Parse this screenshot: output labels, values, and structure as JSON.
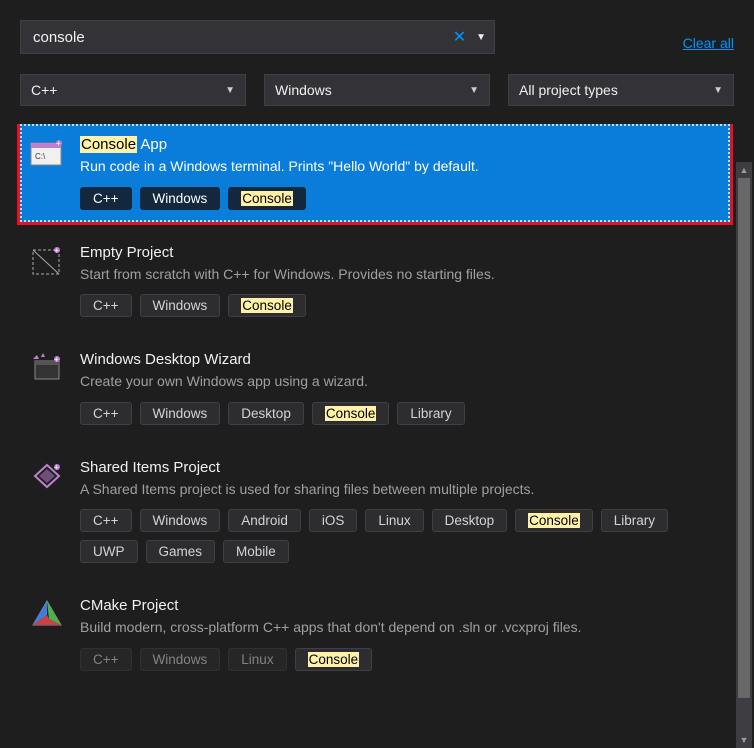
{
  "search": {
    "value": "console"
  },
  "clear_all": "Clear all",
  "filters": {
    "language": "C++",
    "platform": "Windows",
    "project_type": "All project types"
  },
  "templates": [
    {
      "title_pre": "Console",
      "title_post": " App",
      "desc": "Run code in a Windows terminal. Prints \"Hello World\" by default.",
      "tags": [
        "C++",
        "Windows"
      ],
      "hl_tags": [
        "Console"
      ],
      "faded_tags": [],
      "selected": true,
      "icon": "console"
    },
    {
      "title_pre": "",
      "title_post": "Empty Project",
      "desc": "Start from scratch with C++ for Windows. Provides no starting files.",
      "tags": [
        "C++",
        "Windows"
      ],
      "hl_tags": [
        "Console"
      ],
      "faded_tags": [],
      "selected": false,
      "icon": "empty"
    },
    {
      "title_pre": "",
      "title_post": "Windows Desktop Wizard",
      "desc": "Create your own Windows app using a wizard.",
      "tags": [
        "C++",
        "Windows",
        "Desktop"
      ],
      "hl_tags": [
        "Console"
      ],
      "faded_tags": [
        "Library"
      ],
      "selected": false,
      "icon": "wizard"
    },
    {
      "title_pre": "",
      "title_post": "Shared Items Project",
      "desc": "A Shared Items project is used for sharing files between multiple projects.",
      "tags": [
        "C++",
        "Windows",
        "Android",
        "iOS",
        "Linux",
        "Desktop"
      ],
      "hl_tags": [
        "Console"
      ],
      "faded_tags": [
        "Library",
        "UWP",
        "Games",
        "Mobile"
      ],
      "selected": false,
      "icon": "shared"
    },
    {
      "title_pre": "",
      "title_post": "CMake Project",
      "desc": "Build modern, cross-platform C++ apps that don't depend on .sln or .vcxproj files.",
      "tags": [],
      "hl_tags": [
        "Console"
      ],
      "faded_tags": [
        "C++",
        "Windows",
        "Linux"
      ],
      "selected": false,
      "icon": "cmake"
    }
  ]
}
